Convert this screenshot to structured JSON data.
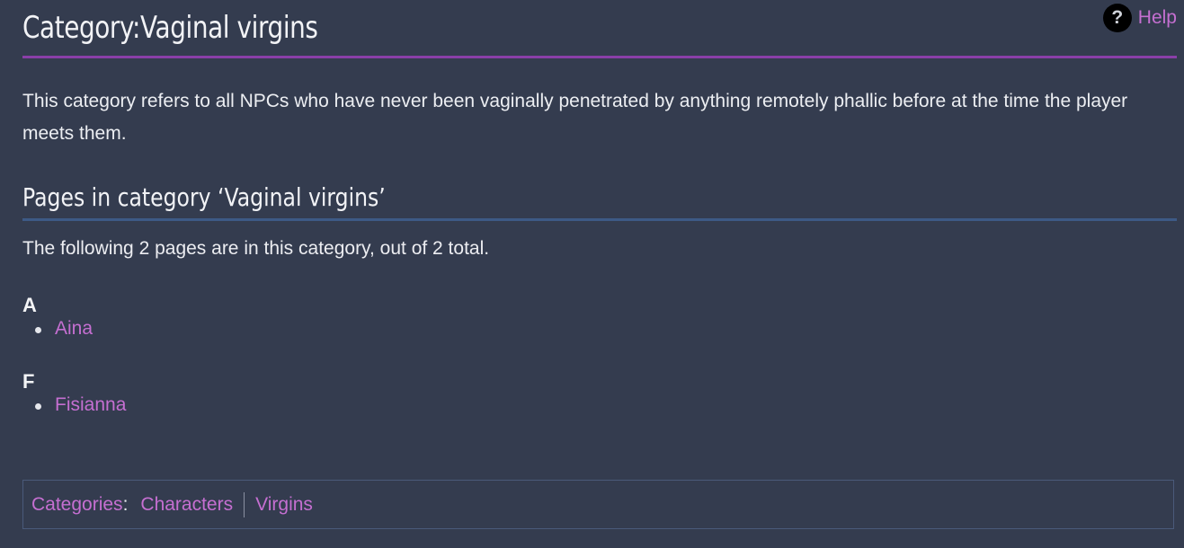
{
  "help": {
    "icon": "question-mark-icon",
    "icon_glyph": "?",
    "label": "Help"
  },
  "page": {
    "title": "Category:Vaginal virgins",
    "intro": "This category refers to all NPCs who have never been vaginally penetrated by anything remotely phallic before at the time the player meets them.",
    "section_heading": "Pages in category ‘Vaginal virgins’",
    "count_text": "The following 2 pages are in this category, out of 2 total.",
    "groups": [
      {
        "letter": "A",
        "pages": [
          "Aina"
        ]
      },
      {
        "letter": "F",
        "pages": [
          "Fisianna"
        ]
      }
    ]
  },
  "categories": {
    "label": "Categories",
    "colon": ":",
    "items": [
      "Characters",
      "Virgins"
    ]
  },
  "colors": {
    "background": "#343c4f",
    "link": "#c56fd1",
    "title_rule": "#8a3fa8",
    "section_rule": "#3d5a86"
  }
}
